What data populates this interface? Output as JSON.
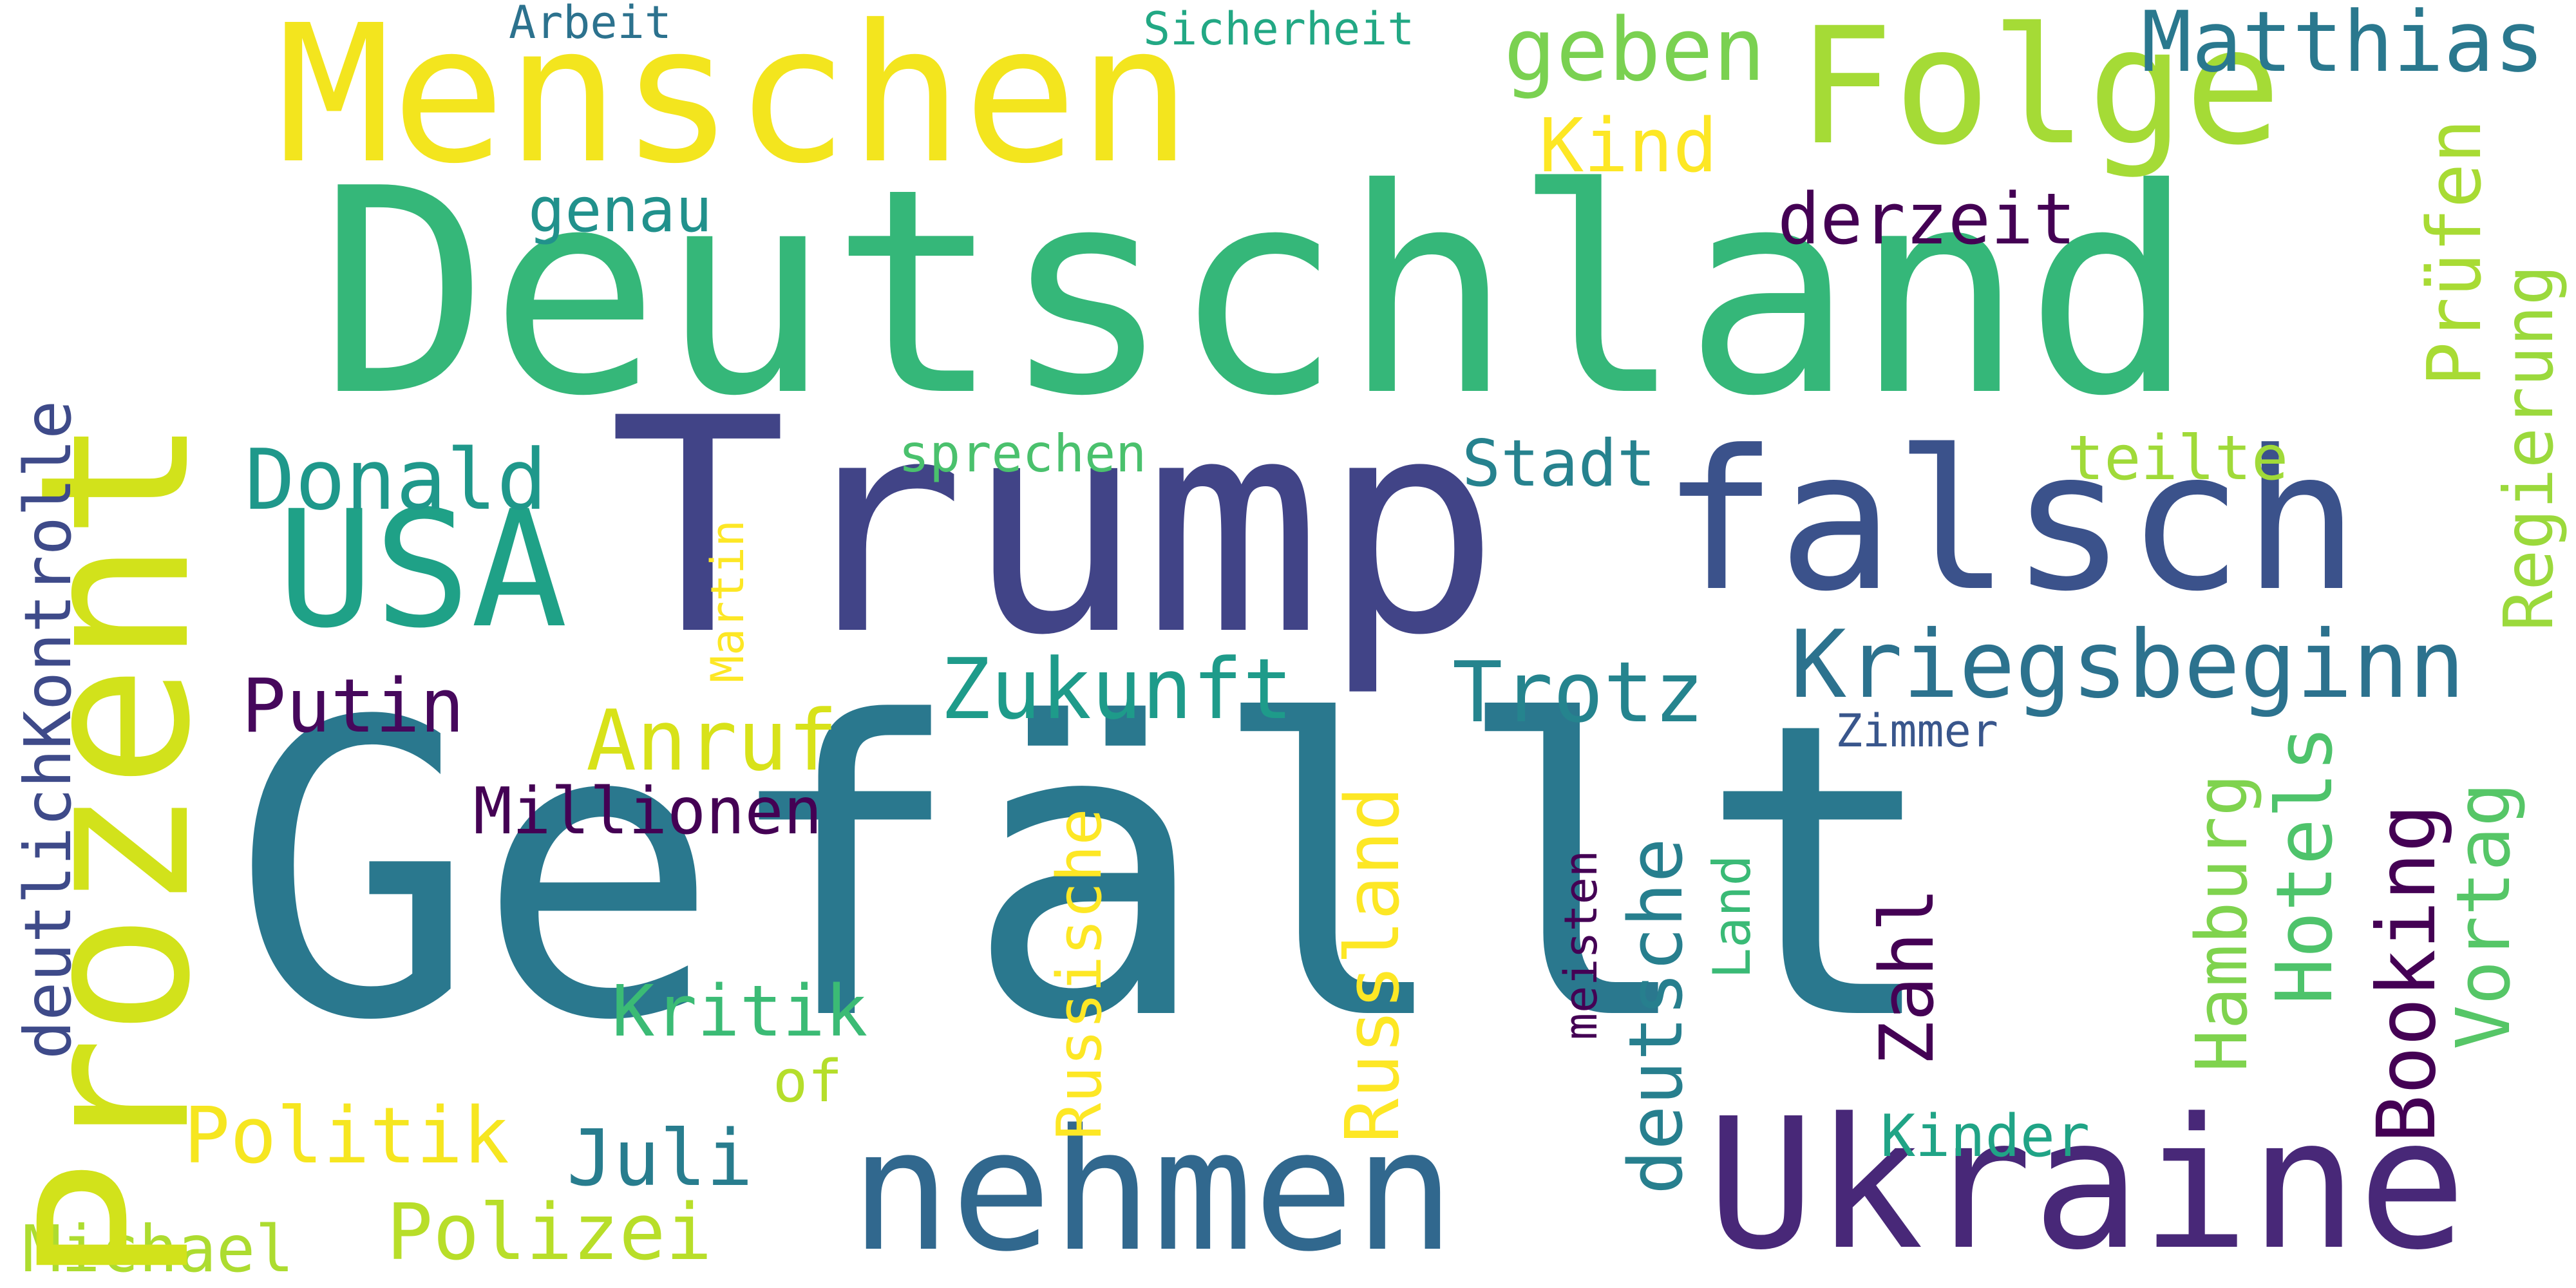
{
  "words": {
    "gefaellt": {
      "text": "Gefällt",
      "color": "#2a788e"
    },
    "deutschland": {
      "text": "Deutschland",
      "color": "#35b779"
    },
    "trump": {
      "text": "Trump",
      "color": "#414487"
    },
    "falsch": {
      "text": "falsch",
      "color": "#3b528b"
    },
    "ukraine": {
      "text": "Ukraine",
      "color": "#482878"
    },
    "nehmen": {
      "text": "nehmen",
      "color": "#31688e"
    },
    "menschen": {
      "text": "Menschen",
      "color": "#f3e51e"
    },
    "folge": {
      "text": "Folge",
      "color": "#a5db36"
    },
    "prozent": {
      "text": "Prozent",
      "color": "#d2e21b"
    },
    "usa": {
      "text": "USA",
      "color": "#1fa187"
    },
    "kriegsbeginn": {
      "text": "Kriegsbeginn",
      "color": "#2c728e"
    },
    "matthias": {
      "text": "Matthias",
      "color": "#2a788e"
    },
    "geben": {
      "text": "geben",
      "color": "#7ad151"
    },
    "kind": {
      "text": "Kind",
      "color": "#fde725"
    },
    "derzeit": {
      "text": "derzeit",
      "color": "#440154"
    },
    "genau": {
      "text": "genau",
      "color": "#21918c"
    },
    "donald": {
      "text": "Donald",
      "color": "#1f988b"
    },
    "stadt": {
      "text": "Stadt",
      "color": "#26828e"
    },
    "teilte": {
      "text": "teilte",
      "color": "#a0da39"
    },
    "sprechen": {
      "text": "sprechen",
      "color": "#4ac16d"
    },
    "putin": {
      "text": "Putin",
      "color": "#46085c"
    },
    "anruf": {
      "text": "Anruf",
      "color": "#d8e219"
    },
    "zukunft": {
      "text": "Zukunft",
      "color": "#1e9b8a"
    },
    "trotz": {
      "text": "Trotz",
      "color": "#25848e"
    },
    "zimmer": {
      "text": "Zimmer",
      "color": "#39568c"
    },
    "millionen": {
      "text": "Millionen",
      "color": "#440154"
    },
    "kritik": {
      "text": "Kritik",
      "color": "#3bbb75"
    },
    "of": {
      "text": "of",
      "color": "#b5de2b"
    },
    "politik": {
      "text": "Politik",
      "color": "#f6e620"
    },
    "juli": {
      "text": "Juli",
      "color": "#287d8e"
    },
    "polizei": {
      "text": "Polizei",
      "color": "#b8de29"
    },
    "michael": {
      "text": "Michael",
      "color": "#addc30"
    },
    "kinder": {
      "text": "Kinder",
      "color": "#20a486"
    },
    "arbeit": {
      "text": "Arbeit",
      "color": "#2c728e"
    },
    "sicherheit": {
      "text": "Sicherheit",
      "color": "#22a884"
    },
    "deutlichkontrolle": {
      "text": "deutlichKontrolle",
      "color": "#3e4a89"
    },
    "martin": {
      "text": "Martin",
      "color": "#fde725"
    },
    "russische": {
      "text": "Russische",
      "color": "#fde725"
    },
    "russland": {
      "text": "Russland",
      "color": "#fde725"
    },
    "meisten": {
      "text": "meisten",
      "color": "#440154"
    },
    "deutsche": {
      "text": "deutsche",
      "color": "#277f8e"
    },
    "land": {
      "text": "Land",
      "color": "#3aba76"
    },
    "zahl": {
      "text": "Zahl",
      "color": "#440154"
    },
    "hamburg": {
      "text": "Hamburg",
      "color": "#7fd34e"
    },
    "hotels": {
      "text": "Hotels",
      "color": "#4ec36b"
    },
    "booking": {
      "text": "Booking",
      "color": "#440154"
    },
    "vortag": {
      "text": "Vortag",
      "color": "#56c667"
    },
    "pruefen": {
      "text": "Prüfen",
      "color": "#a8db34"
    },
    "regierung": {
      "text": "Regierung",
      "color": "#9bd93c"
    }
  }
}
